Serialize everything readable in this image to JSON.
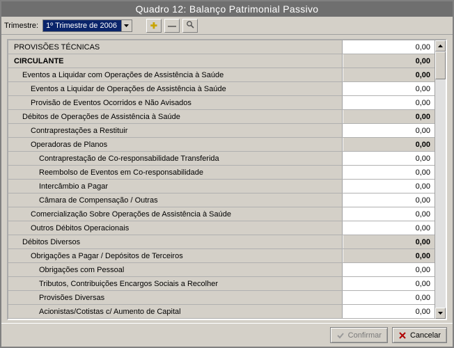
{
  "window": {
    "title": "Quadro 12: Balanço Patrimonial Passivo"
  },
  "toolbar": {
    "trimestre_label": "Trimestre:",
    "trimestre_value": "1º Trimestre de 2006"
  },
  "buttons": {
    "confirm": "Confirmar",
    "cancel": "Cancelar"
  },
  "rows": [
    {
      "label": "PROVISÕES TÉCNICAS",
      "value": "0,00",
      "level": 0,
      "type": "item"
    },
    {
      "label": "CIRCULANTE",
      "value": "0,00",
      "level": 0,
      "type": "header"
    },
    {
      "label": "Eventos a Liquidar com Operações de Assistência à Saúde",
      "value": "0,00",
      "level": 1,
      "type": "subheader"
    },
    {
      "label": "Eventos a Liquidar de Operações de Assistência à Saúde",
      "value": "0,00",
      "level": 2,
      "type": "item"
    },
    {
      "label": "Provisão de Eventos Ocorridos e Não Avisados",
      "value": "0,00",
      "level": 2,
      "type": "item"
    },
    {
      "label": "Débitos de Operações de Assistência à Saúde",
      "value": "0,00",
      "level": 1,
      "type": "subheader"
    },
    {
      "label": "Contraprestações a Restituir",
      "value": "0,00",
      "level": 2,
      "type": "item"
    },
    {
      "label": "Operadoras de Planos",
      "value": "0,00",
      "level": 2,
      "type": "subheader"
    },
    {
      "label": "Contraprestação de Co-responsabilidade Transferida",
      "value": "0,00",
      "level": 3,
      "type": "item"
    },
    {
      "label": "Reembolso de Eventos em Co-responsabilidade",
      "value": "0,00",
      "level": 3,
      "type": "item"
    },
    {
      "label": "Intercâmbio a Pagar",
      "value": "0,00",
      "level": 3,
      "type": "item"
    },
    {
      "label": "Câmara de Compensação / Outras",
      "value": "0,00",
      "level": 3,
      "type": "item"
    },
    {
      "label": "Comercialização Sobre Operações de Assistência à Saúde",
      "value": "0,00",
      "level": 2,
      "type": "item"
    },
    {
      "label": "Outros Débitos Operacionais",
      "value": "0,00",
      "level": 2,
      "type": "item"
    },
    {
      "label": "Débitos Diversos",
      "value": "0,00",
      "level": 1,
      "type": "subheader"
    },
    {
      "label": "Obrigações a Pagar / Depósitos de Terceiros",
      "value": "0,00",
      "level": 2,
      "type": "subheader"
    },
    {
      "label": "Obrigações com Pessoal",
      "value": "0,00",
      "level": 3,
      "type": "item"
    },
    {
      "label": "Tributos, Contribuições Encargos Sociais a Recolher",
      "value": "0,00",
      "level": 3,
      "type": "item"
    },
    {
      "label": "Provisões Diversas",
      "value": "0,00",
      "level": 3,
      "type": "item"
    },
    {
      "label": "Acionistas/Cotistas c/ Aumento de Capital",
      "value": "0,00",
      "level": 3,
      "type": "item"
    }
  ]
}
